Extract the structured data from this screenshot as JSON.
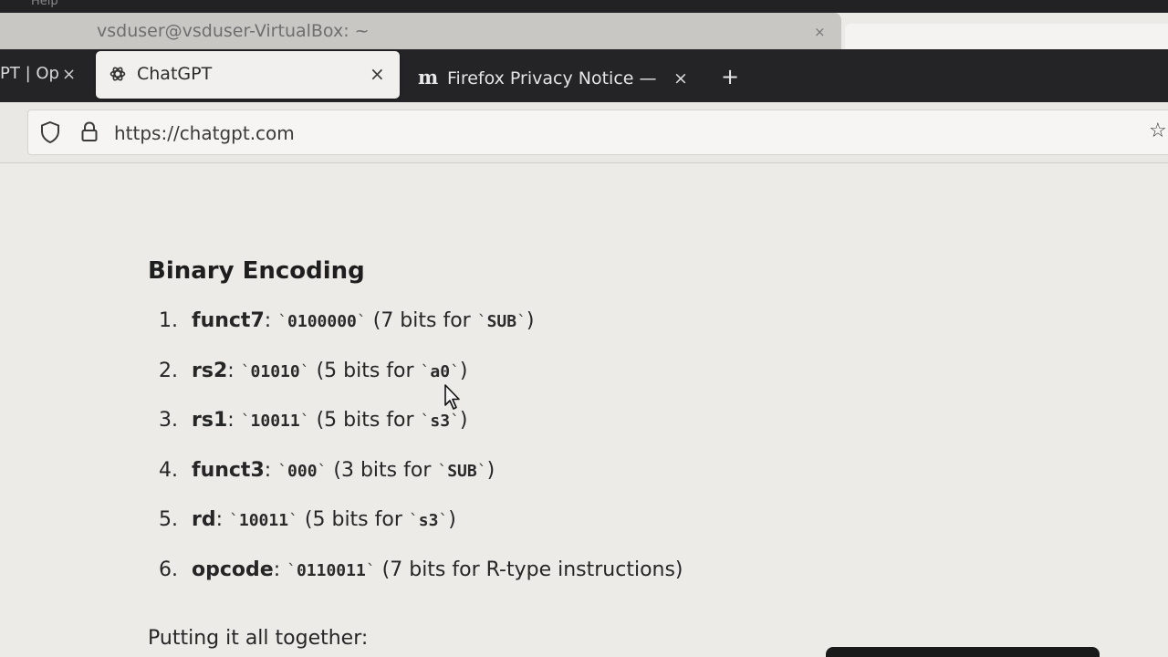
{
  "system": {
    "menu_text": "Help"
  },
  "background_window": {
    "title": "vsduser@vsduser-VirtualBox: ~",
    "close_label": "×"
  },
  "tabs": [
    {
      "label": "PT | Op",
      "close_label": "×",
      "state": "partial"
    },
    {
      "label": "ChatGPT",
      "close_label": "×",
      "state": "active",
      "icon": "openai-logo-icon"
    },
    {
      "label": "Firefox Privacy Notice —",
      "close_label": "×",
      "state": "inactive",
      "icon": "mozilla-m-icon",
      "icon_glyph": "m"
    }
  ],
  "new_tab_label": "+",
  "urlbar": {
    "url": "https://chatgpt.com",
    "icons": [
      "shield-icon",
      "lock-icon",
      "bookmark-star-icon"
    ]
  },
  "content": {
    "heading": "Binary Encoding",
    "steps": [
      {
        "num": "1.",
        "term": "funct7",
        "sep": ":",
        "code": "0100000",
        "desc_pre": "(7 bits for",
        "desc_code": "SUB",
        "desc_post": ")"
      },
      {
        "num": "2.",
        "term": "rs2",
        "sep": ":",
        "code": "01010",
        "desc_pre": "(5 bits for",
        "desc_code": "a0",
        "desc_post": ")"
      },
      {
        "num": "3.",
        "term": "rs1",
        "sep": ":",
        "code": "10011",
        "desc_pre": "(5 bits for",
        "desc_code": "s3",
        "desc_post": ")"
      },
      {
        "num": "4.",
        "term": "funct3",
        "sep": ":",
        "code": "000",
        "desc_pre": "(3 bits for",
        "desc_code": "SUB",
        "desc_post": ")"
      },
      {
        "num": "5.",
        "term": "rd",
        "sep": ":",
        "code": "10011",
        "desc_pre": "(5 bits for",
        "desc_code": "s3",
        "desc_post": ")"
      },
      {
        "num": "6.",
        "term": "opcode",
        "sep": ":",
        "code": "0110011",
        "desc_pre": "(7 bits for R-type instructions)",
        "desc_code": "",
        "desc_post": ""
      }
    ],
    "closing": "Putting it all together:"
  },
  "colors": {
    "page_bg": "#ecebe7",
    "tabbar_bg": "#242427",
    "active_tab_bg": "#f1f0ee",
    "text": "#262626"
  }
}
